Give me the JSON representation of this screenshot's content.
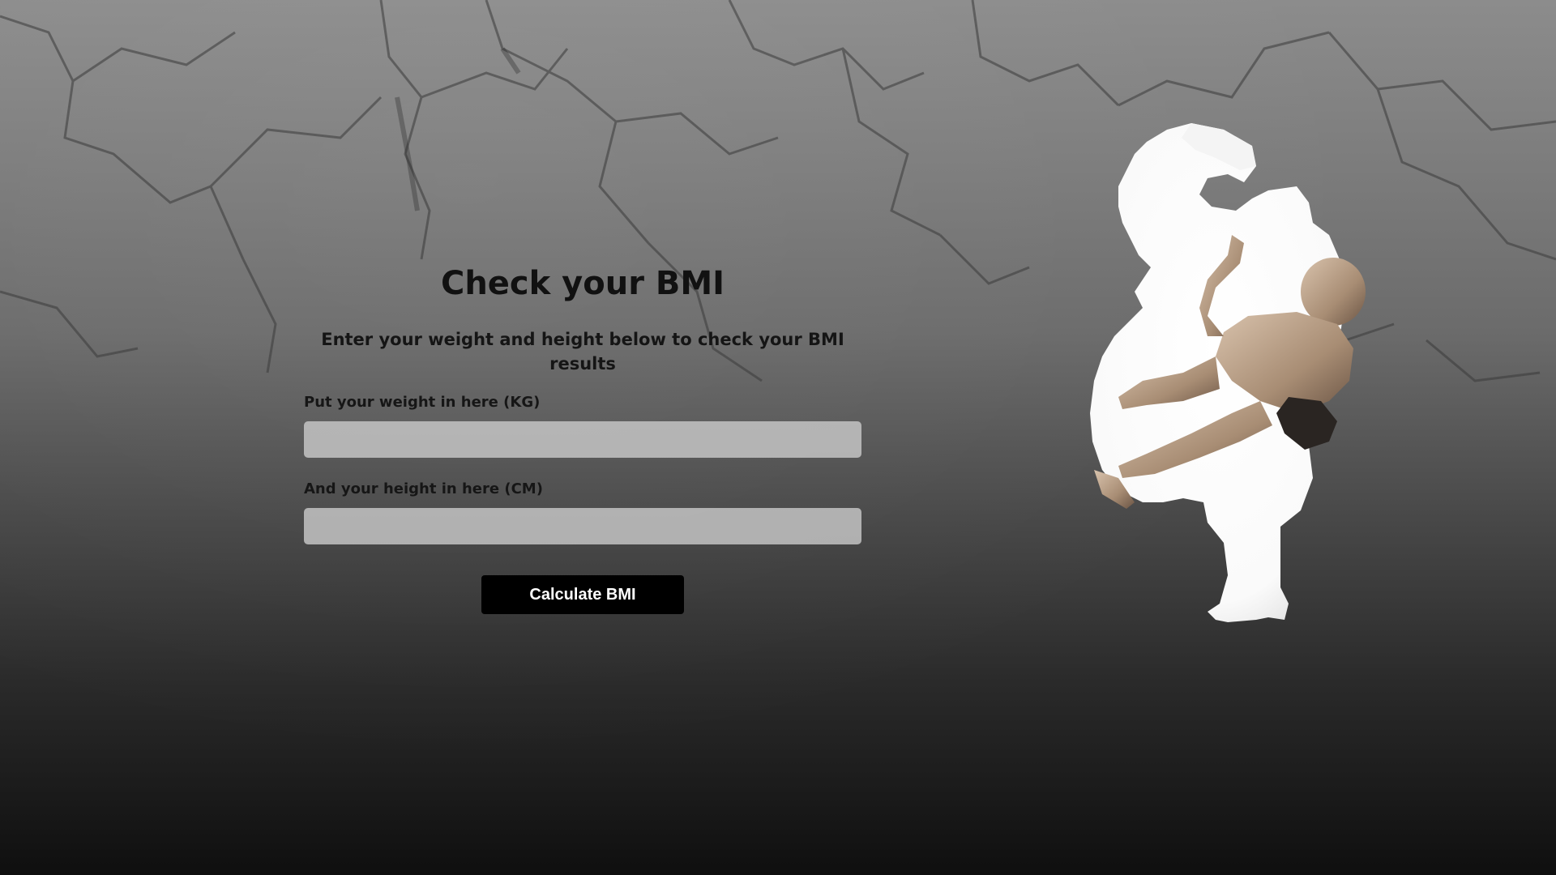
{
  "page": {
    "title": "Check your BMI",
    "subtitle": "Enter your weight and height below to check your BMI results"
  },
  "form": {
    "weight_label": "Put your weight in here (KG)",
    "weight_value": "",
    "weight_placeholder": "",
    "height_label": "And your height in here (CM)",
    "height_value": "",
    "height_placeholder": "",
    "submit_label": "Calculate BMI"
  },
  "image": {
    "subject": "athlete-silhouette"
  },
  "colors": {
    "button_background": "#000000",
    "button_text": "#ffffff",
    "input_background": "#c8c8c8",
    "text": "#111111"
  }
}
